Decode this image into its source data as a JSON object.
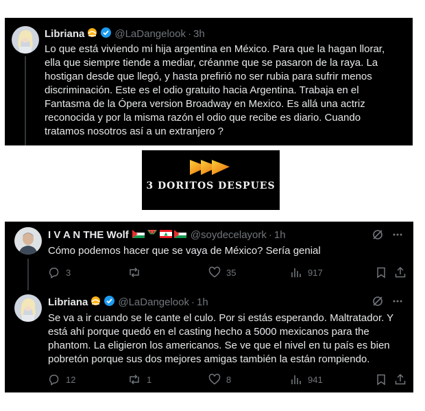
{
  "tweet1": {
    "name": "Libriana",
    "handle": "@LaDangelook",
    "time": "3h",
    "text": "Lo que está viviendo mi hija argentina en México. Para que la hagan llorar,\nella que siempre tiende a mediar, créanme que se pasaron de la raya. La\nhostigan desde que llegó, y hasta prefirió no ser rubia para sufrir menos\ndiscriminación. Este es el odio gratuito hacia Argentina. Trabaja en el\nFantasma de la Ópera version Broadway en Mexico. Es allá una actriz\nreconocida y por la misma razón el odio que recibe es diario. Cuando\ntratamos nosotros así a un extranjero ?"
  },
  "meme": {
    "caption": "3 DORITOS DESPUES"
  },
  "reply1": {
    "name": "I V A N THE Wolf",
    "handle": "@soydecelayork",
    "time": "1h",
    "text": "Cómo podemos hacer que se vaya de México? Sería genial",
    "stats": {
      "replies": "3",
      "reposts": "",
      "likes": "35",
      "views": "917"
    }
  },
  "reply2": {
    "name": "Libriana",
    "handle": "@LaDangelook",
    "time": "1h",
    "text": "Se va a ir cuando se le cante el culo. Por si estás esperando. Maltratador. Y\nestá ahí porque quedó en el casting hecho a 5000 mexicanos para the\nphantom. La eligieron los americanos. Se ve que el nivel en tu país es bien\npobretón porque sus dos mejores amigas también la están rompiendo.",
    "stats": {
      "replies": "12",
      "reposts": "1",
      "likes": "8",
      "views": "941"
    }
  },
  "colors": {
    "bg": "#000000",
    "text": "#e7e9ea",
    "muted": "#71767b",
    "verified": "#1d9bf0"
  },
  "icons": [
    "reply-icon",
    "repost-icon",
    "like-icon",
    "views-icon",
    "bookmark-icon",
    "share-icon",
    "grok-icon",
    "more-icon",
    "verified-icon"
  ]
}
